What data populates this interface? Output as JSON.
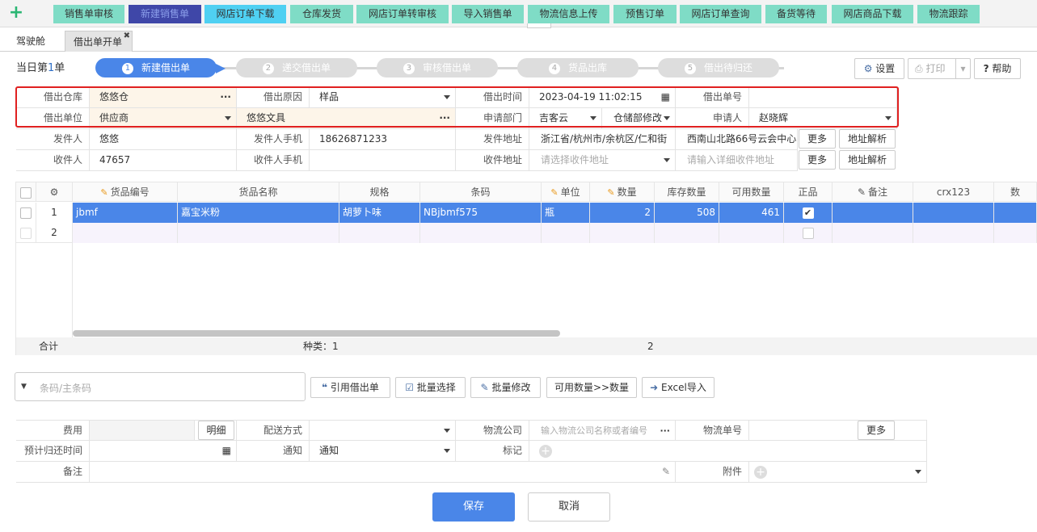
{
  "topnav": [
    "销售单审核",
    "新建销售单",
    "网店订单下载",
    "仓库发货",
    "网店订单转审核",
    "导入销售单",
    "物流信息上传",
    "预售订单",
    "网店订单查询",
    "备货等待",
    "网店商品下载",
    "物流跟踪"
  ],
  "tabs": [
    "驾驶舱",
    "借出单开单"
  ],
  "today": {
    "prefix": "当日第",
    "num": "1",
    "suffix": "单"
  },
  "steps": [
    "新建借出单",
    "递交借出单",
    "审核借出单",
    "货品出库",
    "借出待归还"
  ],
  "step_nums": [
    "1",
    "2",
    "3",
    "4",
    "5"
  ],
  "buttons": {
    "settings": "设置",
    "print": "打印",
    "help": "帮助"
  },
  "form": {
    "row1": {
      "l1": "借出仓库",
      "v1": "悠悠仓",
      "l2": "借出原因",
      "v2": "样品",
      "l3": "借出时间",
      "v3": "2023-04-19 11:02:15",
      "l4": "借出单号",
      "v4": ""
    },
    "row2": {
      "l1": "借出单位",
      "v1": "供应商",
      "v1b": "悠悠文具",
      "l3": "申请部门",
      "v3": "吉客云",
      "v3b": "仓储部修改",
      "l4": "申请人",
      "v4": "赵晓辉"
    },
    "row3": {
      "l1": "发件人",
      "v1": "悠悠",
      "l2": "发件人手机",
      "v2": "18626871233",
      "l3": "发件地址",
      "v3": "浙江省/杭州市/余杭区/仁和街",
      "v4": "西南山北路66号云会中心",
      "more": "更多",
      "parse": "地址解析"
    },
    "row4": {
      "l1": "收件人",
      "v1": "47657",
      "l2": "收件人手机",
      "v2": "",
      "l3": "收件地址",
      "v3ph": "请选择收件地址",
      "v4ph": "请输入详细收件地址",
      "more": "更多",
      "parse": "地址解析"
    }
  },
  "grid": {
    "headers": [
      "货品编号",
      "货品名称",
      "规格",
      "条码",
      "单位",
      "数量",
      "库存数量",
      "可用数量",
      "正品",
      "备注",
      "crx123",
      "数"
    ],
    "rows": [
      {
        "n": "1",
        "code": "jbmf",
        "name": "嘉宝米粉",
        "spec": "胡萝卜味",
        "barcode": "NBjbmf575",
        "unit": "瓶",
        "qty": "2",
        "stock": "508",
        "avail": "461"
      },
      {
        "n": "2",
        "code": "",
        "name": "",
        "spec": "",
        "barcode": "",
        "unit": "",
        "qty": "",
        "stock": "",
        "avail": ""
      }
    ],
    "footer": {
      "label": "合计",
      "kinds": "种类：1",
      "qty": "2"
    }
  },
  "search_ph": "条码/主条码",
  "actions": [
    "引用借出单",
    "批量选择",
    "批量修改",
    "可用数量>>数量",
    "Excel导入"
  ],
  "bottom": {
    "fee": "费用",
    "detail": "明细",
    "ship": "配送方式",
    "logi": "物流公司",
    "logi_ph": "输入物流公司名称或者编号",
    "logino": "物流单号",
    "more": "更多",
    "due": "预计归还时间",
    "notice": "通知",
    "notice_v": "通知",
    "mark": "标记",
    "remark": "备注",
    "attach": "附件"
  },
  "save": "保存",
  "cancel": "取消"
}
